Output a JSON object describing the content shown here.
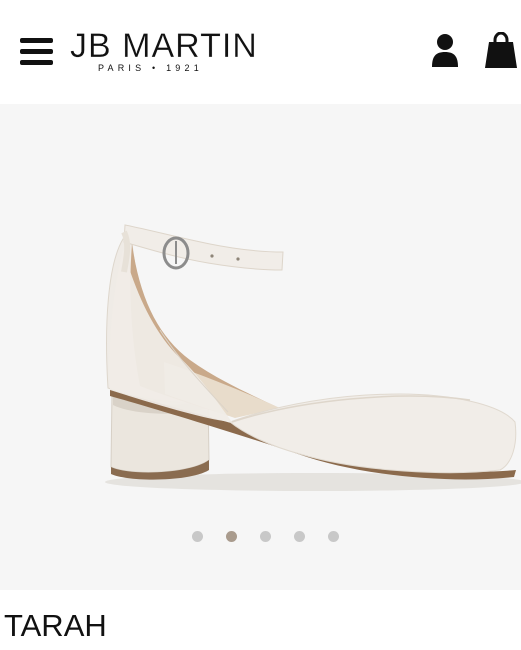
{
  "header": {
    "menu_icon": "hamburger-menu-icon",
    "logo": {
      "name": "JB MARTIN",
      "tagline": "PARIS • 1921"
    },
    "account_icon": "user-icon",
    "cart_icon": "shopping-bag-icon"
  },
  "gallery": {
    "image_description_icon": "product-photo",
    "slide_count": 5,
    "active_slide": 2
  },
  "product": {
    "name": "TARAH"
  },
  "colors": {
    "text": "#111111",
    "gallery_background": "#f6f6f6",
    "dot_inactive": "#c8c8c8",
    "dot_active": "#a99b8d"
  }
}
